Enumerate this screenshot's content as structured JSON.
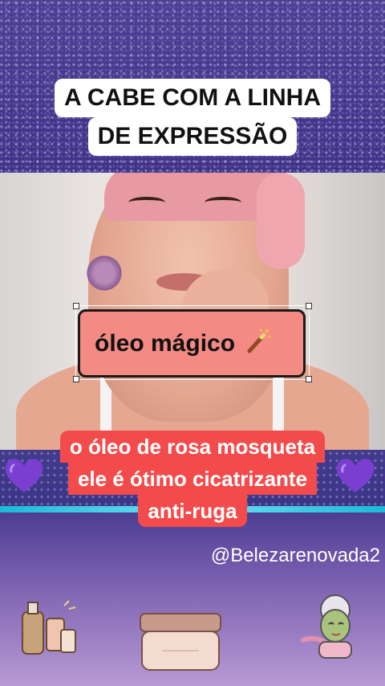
{
  "title": {
    "line1": "A CABE COM A LINHA",
    "line2": "DE EXPRESSÃO"
  },
  "label": {
    "text": "óleo mágico",
    "icon": "magic-wand-icon"
  },
  "caption": {
    "line1": "o óleo de rosa mosqueta",
    "line2": "ele é ótimo cicatrizante",
    "line3": "anti-ruga"
  },
  "account_handle": "@Belezarenovada2",
  "colors": {
    "title_bg": "#ffffff",
    "label_bg": "#f48a84",
    "caption_bg": "#f34b4b",
    "heart": "#7a3fd0",
    "accent_line": "#1fb7d8"
  },
  "decorations": {
    "left_heart": "purple-heart-icon",
    "right_heart": "purple-heart-icon",
    "bottom_left": "bottles-icon",
    "bottom_center": "cream-jar-icon",
    "bottom_right": "face-mask-woman-icon"
  }
}
